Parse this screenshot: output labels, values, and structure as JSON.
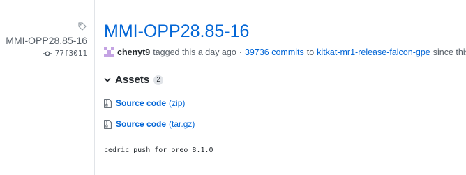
{
  "sidebar": {
    "tag_name": "MMI-OPP28.85-16",
    "commit_sha": "77f3011"
  },
  "release": {
    "title": "MMI-OPP28.85-16",
    "author": "chenyt9",
    "tagged_text": "tagged this a day ago",
    "separator": "·",
    "commits_link": "39736 commits",
    "to_text": "to",
    "branch_link": "kitkat-mr1-release-falcon-gpe",
    "since_text": "since this tag",
    "notes": "cedric push for oreo 8.1.0"
  },
  "assets": {
    "label": "Assets",
    "count": "2",
    "items": [
      {
        "label": "Source code",
        "format": "(zip)",
        "icon": "file-zip-icon"
      },
      {
        "label": "Source code",
        "format": "(tar.gz)",
        "icon": "file-zip-icon"
      }
    ]
  },
  "colors": {
    "link": "#0366d6",
    "text": "#24292e",
    "muted": "#586069",
    "border": "#e1e4e8",
    "avatar": "#c4a3e3"
  }
}
